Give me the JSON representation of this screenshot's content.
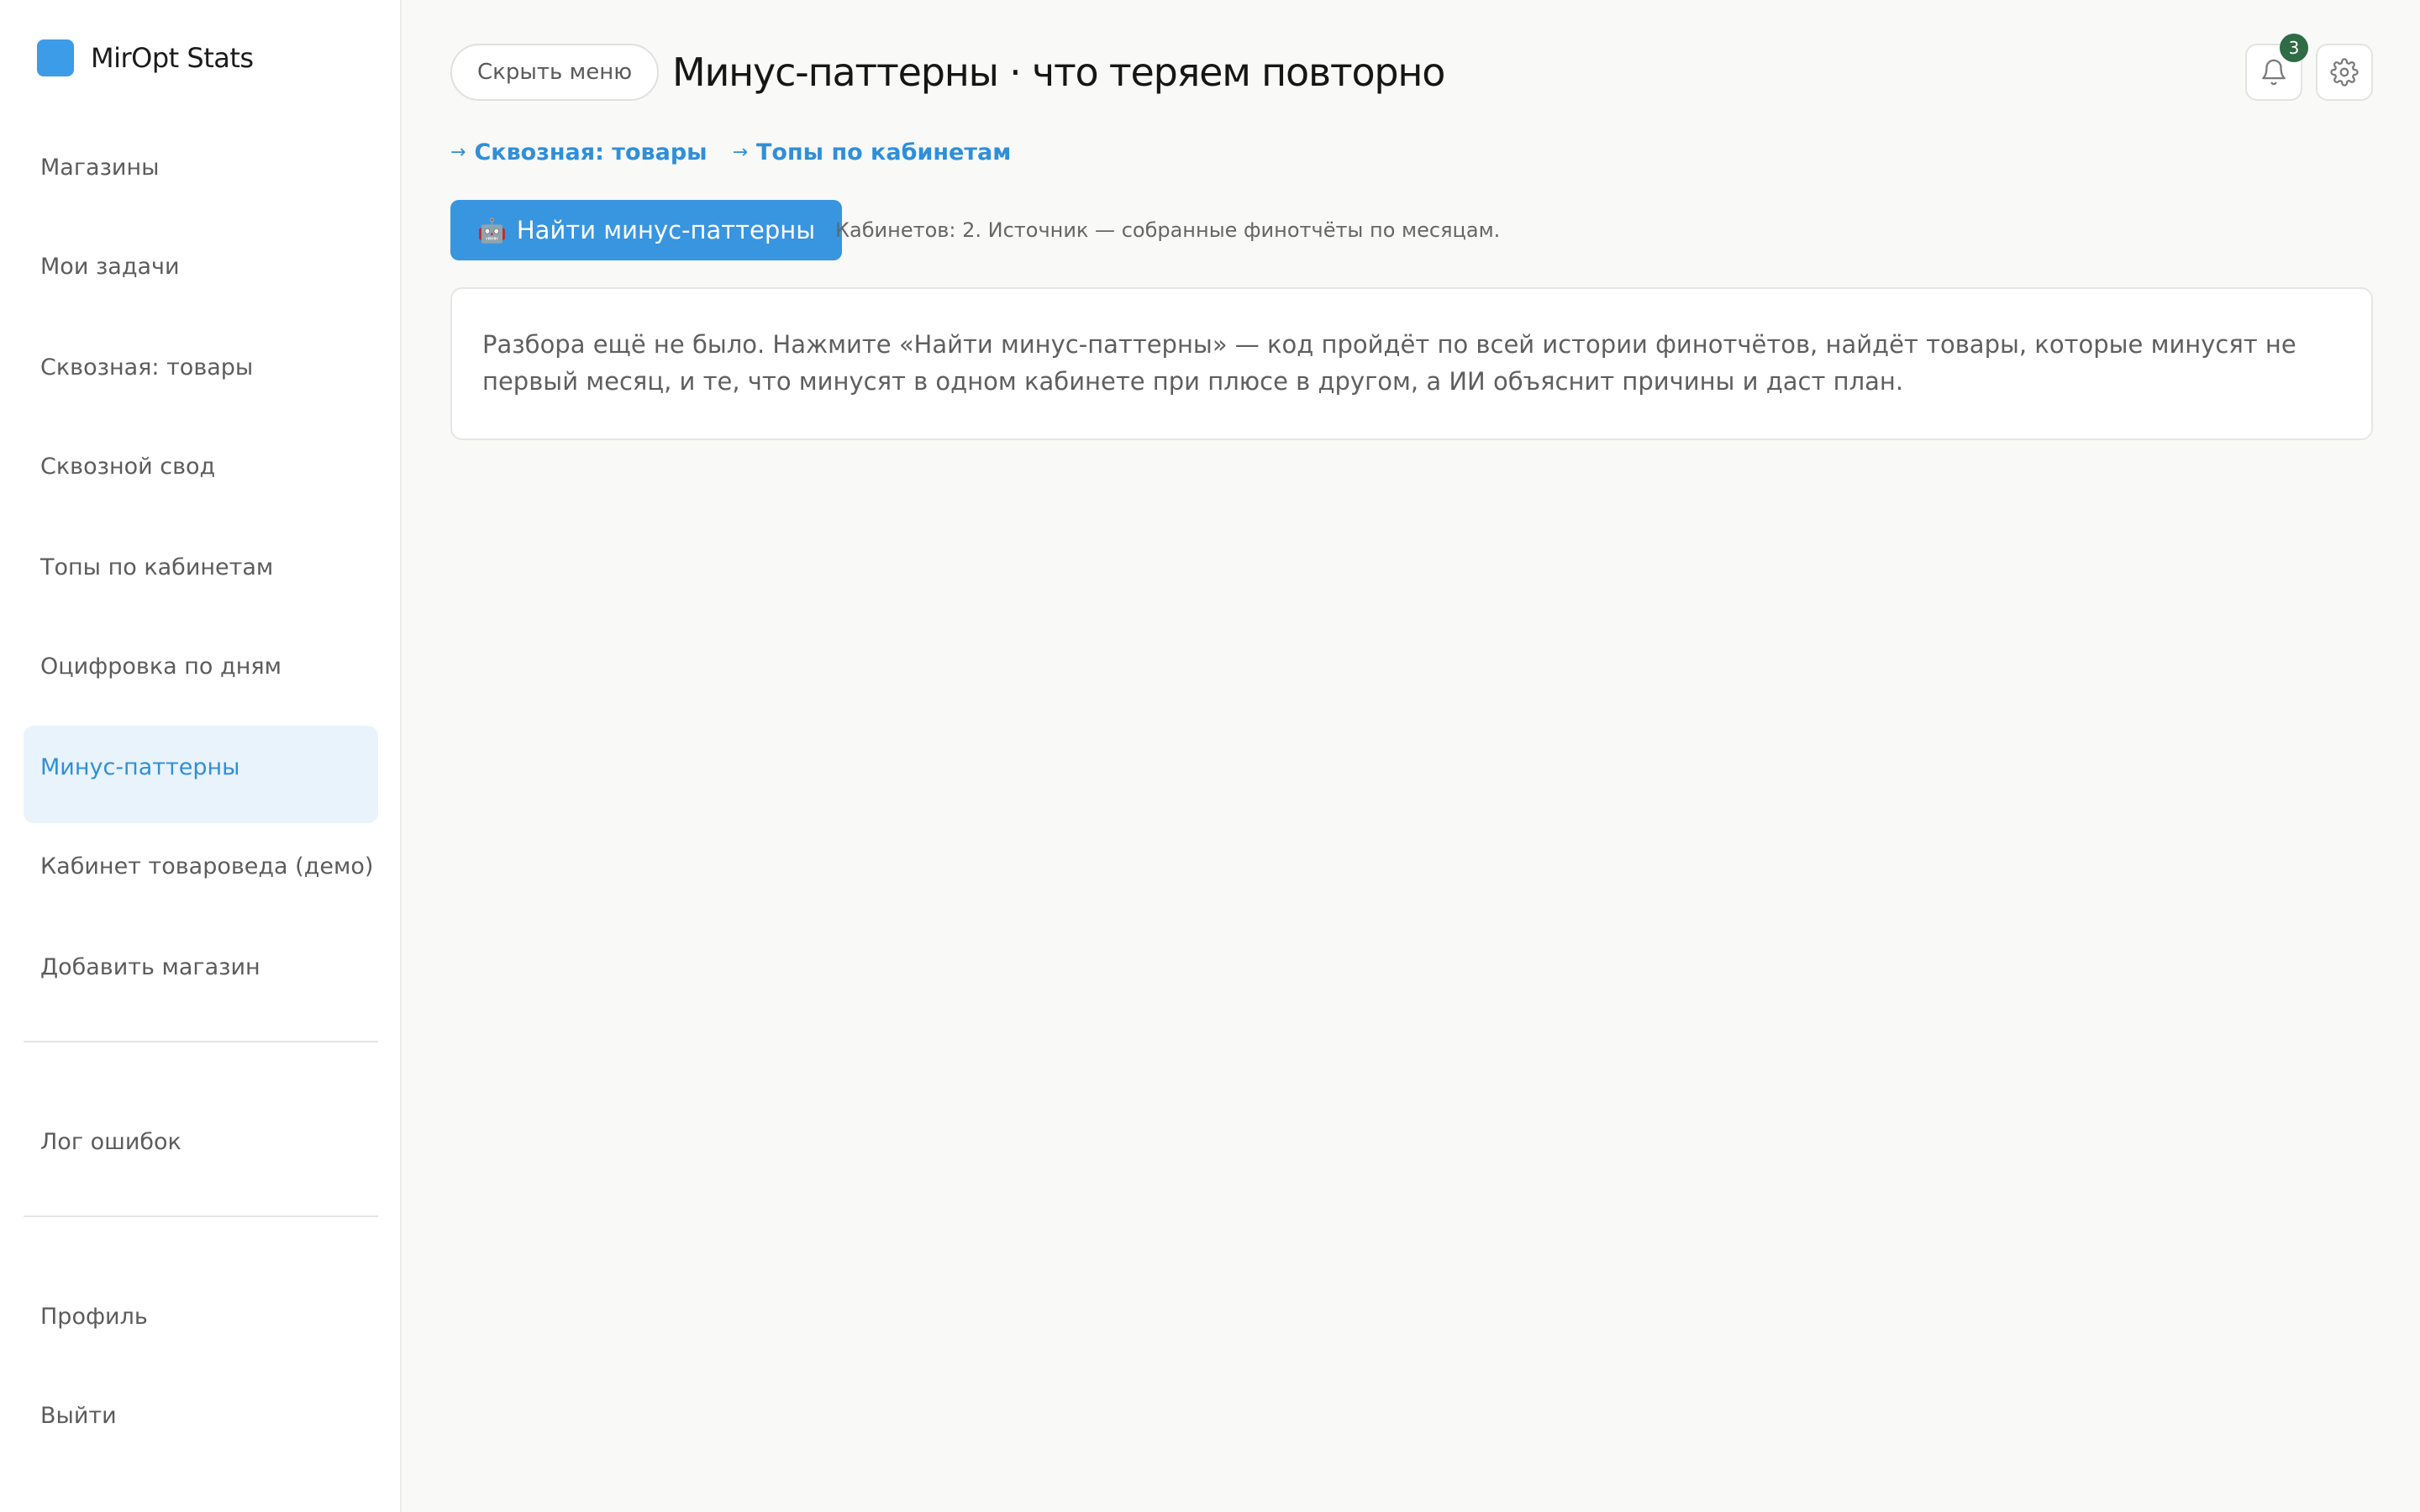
{
  "brand": {
    "name": "MirOpt Stats",
    "color": "#3c9ce8"
  },
  "sidebar": {
    "items": [
      {
        "label": "Магазины"
      },
      {
        "label": "Мои задачи"
      },
      {
        "label": "Сквозная: товары"
      },
      {
        "label": "Сквозной свод"
      },
      {
        "label": "Топы по кабинетам"
      },
      {
        "label": "Оцифровка по дням"
      },
      {
        "label": "Минус-паттерны",
        "active": true
      },
      {
        "label": "Кабинет товароведа (демо)"
      },
      {
        "label": "Добавить магазин"
      }
    ],
    "secondary": [
      {
        "label": "Лог ошибок"
      }
    ],
    "footer": [
      {
        "label": "Профиль"
      },
      {
        "label": "Выйти"
      }
    ]
  },
  "header": {
    "hide_menu_label": "Скрыть меню",
    "title": "Минус-паттерны · что теряем повторно",
    "notifications_count": "3",
    "bell_icon": "bell-icon",
    "settings_icon": "gear-icon"
  },
  "links": [
    {
      "arrow": "→",
      "label": "Сквозная: товары"
    },
    {
      "arrow": "→",
      "label": "Топы по кабинетам"
    }
  ],
  "action": {
    "robot_emoji": "🤖",
    "button_label": "Найти минус-паттерны",
    "hint": "Кабинетов: 2. Источник — собранные финотчёты по месяцам."
  },
  "empty_state": {
    "text": "Разбора ещё не было. Нажмите «Найти минус-паттерны» — код пройдёт по всей истории финотчётов, найдёт товары, которые минусят не первый месяц, и те, что минусят в одном кабинете при плюсе в другом, а ИИ объяснит причины и даст план."
  },
  "colors": {
    "accent": "#3895e0",
    "link": "#2f8fd8",
    "active_bg": "#e9f3fc",
    "badge": "#2f6b45"
  }
}
